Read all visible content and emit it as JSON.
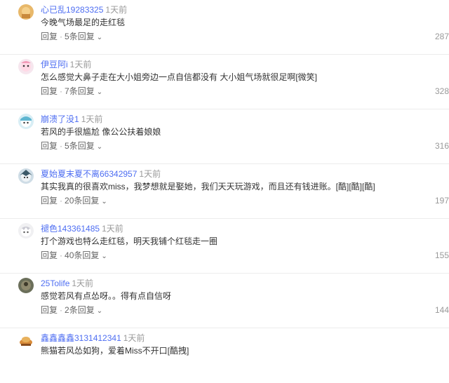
{
  "comments": [
    {
      "user": "心已乱19283325",
      "time": "1天前",
      "text": "今晚气场最足的走红毯",
      "reply": "回复",
      "sub": "5条回复",
      "likes": "287",
      "avatar": "avatar-1"
    },
    {
      "user": "伊豆阿i",
      "time": "1天前",
      "text": "怎么感觉大鼻子走在大小姐旁边一点自信都没有 大小姐气场就很足啊[微笑]",
      "reply": "回复",
      "sub": "7条回复",
      "likes": "328",
      "avatar": "avatar-2"
    },
    {
      "user": "崩溃了没1",
      "time": "1天前",
      "text": "若风的手很尴尬 像公公扶着娘娘",
      "reply": "回复",
      "sub": "5条回复",
      "likes": "316",
      "avatar": "avatar-3"
    },
    {
      "user": "夏始夏末夏不离66342957",
      "time": "1天前",
      "text": "其实我真的很喜欢miss，我梦想就是娶她，我们天天玩游戏，而且还有钱进账。[酷][酷][酷]",
      "reply": "回复",
      "sub": "20条回复",
      "likes": "197",
      "avatar": "avatar-4"
    },
    {
      "user": "褪色143361485",
      "time": "1天前",
      "text": "打个游戏也特么走红毯，明天我铺个红毯走一圈",
      "reply": "回复",
      "sub": "40条回复",
      "likes": "155",
      "avatar": "avatar-5"
    },
    {
      "user": "25Tolife",
      "time": "1天前",
      "text": "感觉若风有点怂呀。。得有点自信呀",
      "reply": "回复",
      "sub": "2条回复",
      "likes": "144",
      "avatar": "avatar-6"
    },
    {
      "user": "鑫鑫鑫鑫3131412341",
      "time": "1天前",
      "text": "熊猫若风怂如狗，爱着Miss不开口[酷拽]",
      "reply": "",
      "sub": "",
      "likes": "",
      "avatar": "avatar-7"
    }
  ],
  "icons": {
    "expand": "chevron-down-icon"
  }
}
